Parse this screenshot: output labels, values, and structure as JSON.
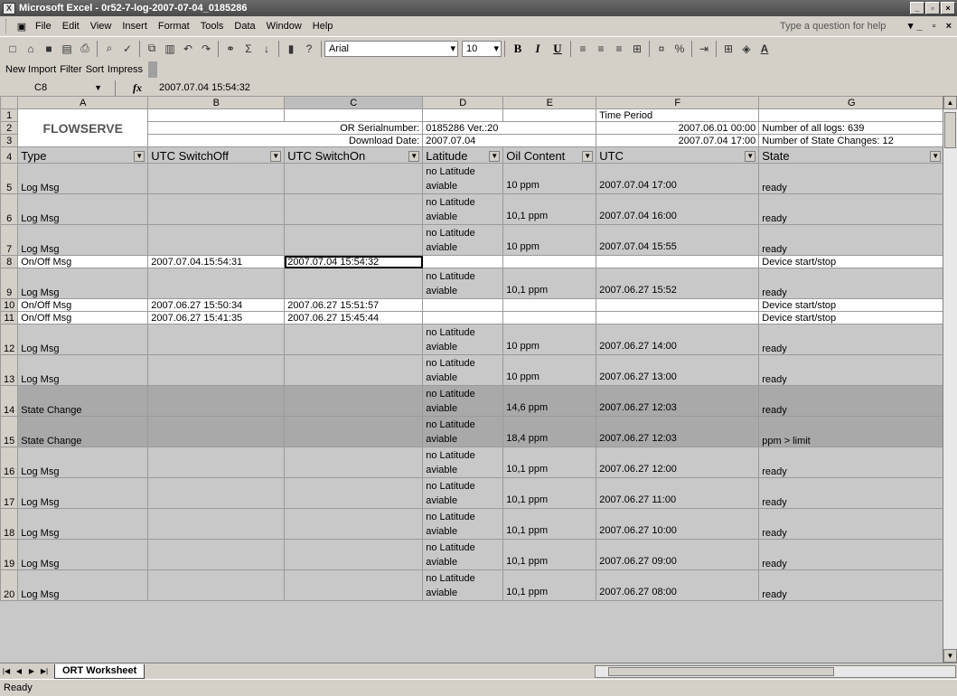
{
  "window": {
    "title": "Microsoft Excel - 0r52-7-log-2007-07-04_0185286",
    "minimize": "_",
    "restore": "▫",
    "close": "×"
  },
  "menu": [
    "File",
    "Edit",
    "View",
    "Insert",
    "Format",
    "Tools",
    "Data",
    "Window",
    "Help"
  ],
  "help_placeholder": "Type a question for help",
  "toolbar": {
    "font_name": "Arial",
    "font_size": "10"
  },
  "custom_toolbar": [
    "New Import",
    "Filter",
    "Sort",
    "Impress"
  ],
  "formula_bar": {
    "name_box": "C8",
    "fx": "fx",
    "value": "2007.07.04 15:54:32"
  },
  "columns": [
    "A",
    "B",
    "C",
    "D",
    "E",
    "F",
    "G"
  ],
  "active_column": "C",
  "header_block": {
    "logo": "FLOWSERVE",
    "serial_label": "OR Serialnumber:",
    "serial_value": "0185286 Ver.:20",
    "download_label": "Download Date:",
    "download_value": "2007.07.04",
    "time_period_label": "Time Period",
    "period_start": "2007.06.01 00:00",
    "period_end": "2007.07.04 17:00",
    "logs_count": "Number of all logs: 639",
    "state_changes": "Number of State Changes: 12"
  },
  "table_headers": [
    "Type",
    "UTC SwitchOff",
    "UTC SwitchOn",
    "Latitude",
    "Oil Content",
    "UTC",
    "State"
  ],
  "rows": [
    {
      "n": "5",
      "style": "gray",
      "type": "Log Msg",
      "off": "",
      "on": "",
      "lat1": "no Latitude",
      "lat2": "aviable",
      "oil": "10 ppm",
      "utc": "2007.07.04 17:00",
      "state": "ready"
    },
    {
      "n": "6",
      "style": "gray",
      "type": "Log Msg",
      "off": "",
      "on": "",
      "lat1": "no Latitude",
      "lat2": "aviable",
      "oil": "10,1 ppm",
      "utc": "2007.07.04 16:00",
      "state": "ready"
    },
    {
      "n": "7",
      "style": "gray",
      "type": "Log Msg",
      "off": "",
      "on": "",
      "lat1": "no Latitude",
      "lat2": "aviable",
      "oil": "10 ppm",
      "utc": "2007.07.04 15:55",
      "state": "ready"
    },
    {
      "n": "8",
      "style": "white",
      "type": "On/Off Msg",
      "off": "2007.07.04.15:54:31",
      "on": "2007.07.04 15:54:32",
      "lat1": "",
      "lat2": "",
      "oil": "",
      "utc": "",
      "state": "Device start/stop"
    },
    {
      "n": "9",
      "style": "gray",
      "type": "Log Msg",
      "off": "",
      "on": "",
      "lat1": "no Latitude",
      "lat2": "aviable",
      "oil": "10,1 ppm",
      "utc": "2007.06.27 15:52",
      "state": "ready"
    },
    {
      "n": "10",
      "style": "white",
      "type": "On/Off Msg",
      "off": "2007.06.27 15:50:34",
      "on": "2007.06.27 15:51:57",
      "lat1": "",
      "lat2": "",
      "oil": "",
      "utc": "",
      "state": "Device start/stop"
    },
    {
      "n": "11",
      "style": "white",
      "type": "On/Off Msg",
      "off": "2007.06.27 15:41:35",
      "on": "2007.06.27 15:45:44",
      "lat1": "",
      "lat2": "",
      "oil": "",
      "utc": "",
      "state": "Device start/stop"
    },
    {
      "n": "12",
      "style": "gray",
      "type": "Log Msg",
      "off": "",
      "on": "",
      "lat1": "no Latitude",
      "lat2": "aviable",
      "oil": "10 ppm",
      "utc": "2007.06.27 14:00",
      "state": "ready"
    },
    {
      "n": "13",
      "style": "gray",
      "type": "Log Msg",
      "off": "",
      "on": "",
      "lat1": "no Latitude",
      "lat2": "aviable",
      "oil": "10 ppm",
      "utc": "2007.06.27 13:00",
      "state": "ready"
    },
    {
      "n": "14",
      "style": "dark",
      "type": "State Change",
      "off": "",
      "on": "",
      "lat1": "no Latitude",
      "lat2": "aviable",
      "oil": "14,6 ppm",
      "utc": "2007.06.27 12:03",
      "state": "ready"
    },
    {
      "n": "15",
      "style": "dark",
      "type": "State Change",
      "off": "",
      "on": "",
      "lat1": "no Latitude",
      "lat2": "aviable",
      "oil": "18,4 ppm",
      "utc": "2007.06.27 12:03",
      "state": "ppm > limit"
    },
    {
      "n": "16",
      "style": "gray",
      "type": "Log Msg",
      "off": "",
      "on": "",
      "lat1": "no Latitude",
      "lat2": "aviable",
      "oil": "10,1 ppm",
      "utc": "2007.06.27 12:00",
      "state": "ready"
    },
    {
      "n": "17",
      "style": "gray",
      "type": "Log Msg",
      "off": "",
      "on": "",
      "lat1": "no Latitude",
      "lat2": "aviable",
      "oil": "10,1 ppm",
      "utc": "2007.06.27 11:00",
      "state": "ready"
    },
    {
      "n": "18",
      "style": "gray",
      "type": "Log Msg",
      "off": "",
      "on": "",
      "lat1": "no Latitude",
      "lat2": "aviable",
      "oil": "10,1 ppm",
      "utc": "2007.06.27 10:00",
      "state": "ready"
    },
    {
      "n": "19",
      "style": "gray",
      "type": "Log Msg",
      "off": "",
      "on": "",
      "lat1": "no Latitude",
      "lat2": "aviable",
      "oil": "10,1 ppm",
      "utc": "2007.06.27 09:00",
      "state": "ready"
    },
    {
      "n": "20",
      "style": "gray",
      "type": "Log Msg",
      "off": "",
      "on": "",
      "lat1": "no Latitude",
      "lat2": "aviable",
      "oil": "10,1 ppm",
      "utc": "2007.06.27 08:00",
      "state": "ready"
    }
  ],
  "sheet_tab": "ORT Worksheet",
  "status": "Ready"
}
